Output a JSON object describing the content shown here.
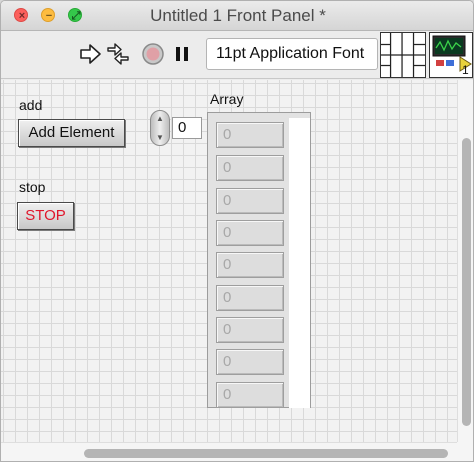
{
  "window": {
    "title": "Untitled 1 Front Panel *"
  },
  "titlebar": {
    "close_glyph": "×",
    "minimize_glyph": "−",
    "maximize_glyph": "⤢"
  },
  "toolbar": {
    "run_icon": "run-arrow-icon",
    "run_continuously_icon": "run-continuously-icon",
    "abort_icon": "abort-execution-icon",
    "pause_icon": "pause-icon",
    "font_select": "11pt Application Font",
    "connector_pane_icon": "connector-pane-icon",
    "vi_icon": "vi-icon",
    "vi_icon_number": "1"
  },
  "controls": {
    "add_label": "add",
    "add_button": "Add Element",
    "stop_label": "stop",
    "stop_button": "STOP",
    "stop_color": "#e0162b"
  },
  "array": {
    "label": "Array",
    "index_value": "0",
    "spinner_up": "▲",
    "spinner_down": "▼",
    "elements": [
      "0",
      "0",
      "0",
      "0",
      "0",
      "0",
      "0",
      "0",
      "0"
    ]
  }
}
